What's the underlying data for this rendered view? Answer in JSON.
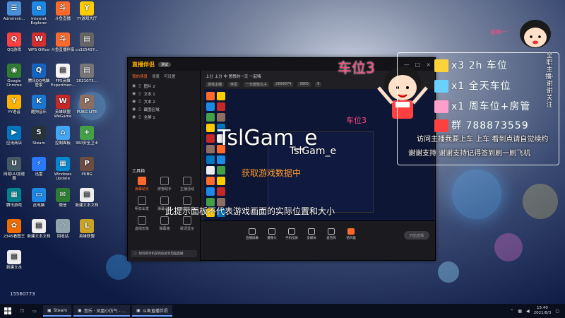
{
  "desktop_icons": [
    {
      "label": "Administr...",
      "color": "#4a90d9",
      "glyph": "☰"
    },
    {
      "label": "Internet Explorer",
      "color": "#1e88e5",
      "glyph": "e"
    },
    {
      "label": "斗鱼直播",
      "color": "#ff6a2a",
      "glyph": "斗"
    },
    {
      "label": "YY游戏大厅",
      "color": "#ffcc00",
      "glyph": "Y"
    },
    {
      "label": "QQ游戏",
      "color": "#ff4040",
      "glyph": "Q"
    },
    {
      "label": "WPS Office",
      "color": "#d32f2f",
      "glyph": "W"
    },
    {
      "label": "斗鱼直播伴侣",
      "color": "#ff6a2a",
      "glyph": "斗"
    },
    {
      "label": "cn325407...",
      "color": "#666666",
      "glyph": "▤"
    },
    {
      "label": "Google Chrome",
      "color": "#2e7d32",
      "glyph": "◉"
    },
    {
      "label": "腾讯QQ电脑管家",
      "color": "#1565c0",
      "glyph": "Q"
    },
    {
      "label": "FPS英雄 Experimen...",
      "color": "#f5f5f5",
      "glyph": "▤"
    },
    {
      "label": "2021073...",
      "color": "#777777",
      "glyph": "▤"
    },
    {
      "label": "YY语音",
      "color": "#ffb300",
      "glyph": "Y"
    },
    {
      "label": "酷狗音乐",
      "color": "#1976d2",
      "glyph": "K"
    },
    {
      "label": "英雄联盟WeGame",
      "color": "#c62828",
      "glyph": "W"
    },
    {
      "label": "PUBG LITE",
      "color": "#8d6e63",
      "glyph": "P"
    },
    {
      "label": "应用商店",
      "color": "#0277bd",
      "glyph": "▶"
    },
    {
      "label": "Steam",
      "color": "#263238",
      "glyph": "S"
    },
    {
      "label": "控制面板",
      "color": "#42a5f5",
      "glyph": "⌂"
    },
    {
      "label": "360安全卫士",
      "color": "#43a047",
      "glyph": "+"
    },
    {
      "label": "网易UU加速器",
      "color": "#455a64",
      "glyph": "U"
    },
    {
      "label": "迅雷",
      "color": "#2979ff",
      "glyph": "⚡"
    },
    {
      "label": "Windows Update",
      "color": "#0288d1",
      "glyph": "▦"
    },
    {
      "label": "PUBG",
      "color": "#6d4c41",
      "glyph": "P"
    },
    {
      "label": "腾讯游戏",
      "color": "#00838f",
      "glyph": "▦"
    },
    {
      "label": "此电脑",
      "color": "#1e88e5",
      "glyph": "▭"
    },
    {
      "label": "微信",
      "color": "#2e7d32",
      "glyph": "✉"
    },
    {
      "label": "新建文本文档",
      "color": "#eeeeee",
      "glyph": "▤"
    },
    {
      "label": "2345看图王",
      "color": "#ef6c00",
      "glyph": "✿"
    },
    {
      "label": "新建文本文档",
      "color": "#eeeeee",
      "glyph": "▤"
    },
    {
      "label": "回收站",
      "color": "#90a4ae",
      "glyph": "♲"
    },
    {
      "label": "英雄联盟",
      "color": "#c9a227",
      "glyph": "L"
    },
    {
      "label": "新建文本",
      "color": "#eeeeee",
      "glyph": "▤"
    }
  ],
  "app": {
    "logo": "直播伴侣",
    "version": "测试",
    "controls": [
      "—",
      "□",
      "×"
    ],
    "left_tabs": [
      "我的场景",
      "场景",
      "可设置"
    ],
    "sources": [
      "图片 2",
      "文本 1",
      "文本 2",
      "截图区域",
      "全屏 1"
    ],
    "tools_title": "工具箱",
    "tools": [
      {
        "label": "弹幕助手",
        "active": true
      },
      {
        "label": "房管助手",
        "active": false
      },
      {
        "label": "主播活动",
        "active": false
      },
      {
        "label": "明日出发",
        "active": false
      },
      {
        "label": "弹幕设置",
        "active": false
      },
      {
        "label": "字幕设置",
        "active": false
      },
      {
        "label": "虚拟形象",
        "active": false
      },
      {
        "label": "弹幕墙",
        "active": false
      },
      {
        "label": "歌词显示",
        "active": false
      }
    ],
    "notice": "如何把手机游戏投屏到电脑直播",
    "room_title": "上分 上分 中 憋憋的一天 一起嗨",
    "room_tags": [
      "游戏主播",
      "伴侣",
      "一日憋憋丸子",
      "2699974",
      "9965",
      "9"
    ],
    "bottom_buttons": [
      "直播屏幕",
      "摄像头",
      "手机投屏",
      "多媒体",
      "麦克风",
      "扬声器"
    ],
    "start_label": "开始直播"
  },
  "overlay": {
    "car_big": "车位3",
    "car_small": "车位3",
    "tsl_big": "TslGam_e",
    "tsl_small": "TslGam_e",
    "fetching": "获取游戏数据中",
    "hint": "此提示面板不代表游戏画面的实际位置和大小"
  },
  "panel": {
    "name_tag": "瘦晚一",
    "rows": [
      {
        "text": "x3  2h 车位",
        "color": "#ffd23a"
      },
      {
        "text": "x1  全天车位",
        "color": "#6ad0ff"
      },
      {
        "text": "x1  周车位+房管",
        "color": "#ff9ec8"
      },
      {
        "text": "群  788873559",
        "color": "#ff4040"
      }
    ],
    "scroll_text": "访问主播我要上车 上车 看到点请自觉续约",
    "scroll_text2": "谢谢支持 谢谢支持记得签到刷一刷飞机",
    "vertical_text": "全职主播·谢谢关注"
  },
  "taskbar": {
    "items": [
      {
        "label": "Steam"
      },
      {
        "label": "音乐 · 凤凰小仿气 - ..."
      },
      {
        "label": "斗鱼直播伴侣"
      }
    ],
    "time": "15:40",
    "date": "2021/8/3"
  },
  "desktop_badge": "15560773"
}
